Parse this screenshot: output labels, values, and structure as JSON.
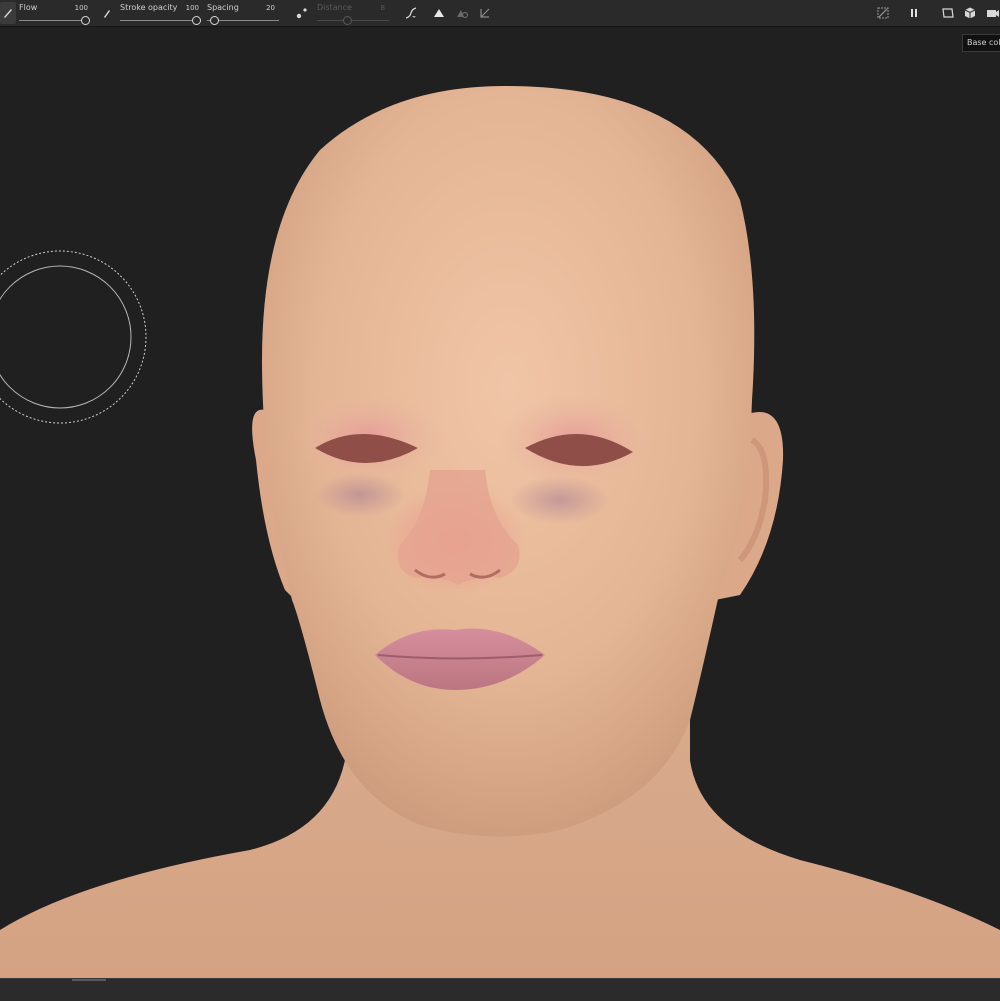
{
  "toolbar": {
    "flow": {
      "label": "Flow",
      "value": "100",
      "level": 1.0
    },
    "stroke_opacity": {
      "label": "Stroke opacity",
      "value": "100",
      "level": 1.0
    },
    "spacing": {
      "label": "Spacing",
      "value": "20",
      "level": 0.05
    },
    "distance": {
      "label": "Distance",
      "value": "8",
      "level": 0.5,
      "enabled": false
    }
  },
  "tooltip": {
    "text": "Base colo"
  },
  "colors": {
    "background": "#202020",
    "toolbar": "#2a2a2a",
    "skin": "#e2b594",
    "lips": "#c7838f",
    "brush_cursor": "#cfcfcf"
  },
  "icons": [
    "brush-icon",
    "stroke-brush-icon",
    "lazy-mouse-icon",
    "pressure-curve-icon",
    "symmetry-icon",
    "symmetry-mirror-icon",
    "transform-icon",
    "hide-icon",
    "pause-icon",
    "camera-frame-icon",
    "3d-view-cube-icon",
    "camera-icon"
  ]
}
